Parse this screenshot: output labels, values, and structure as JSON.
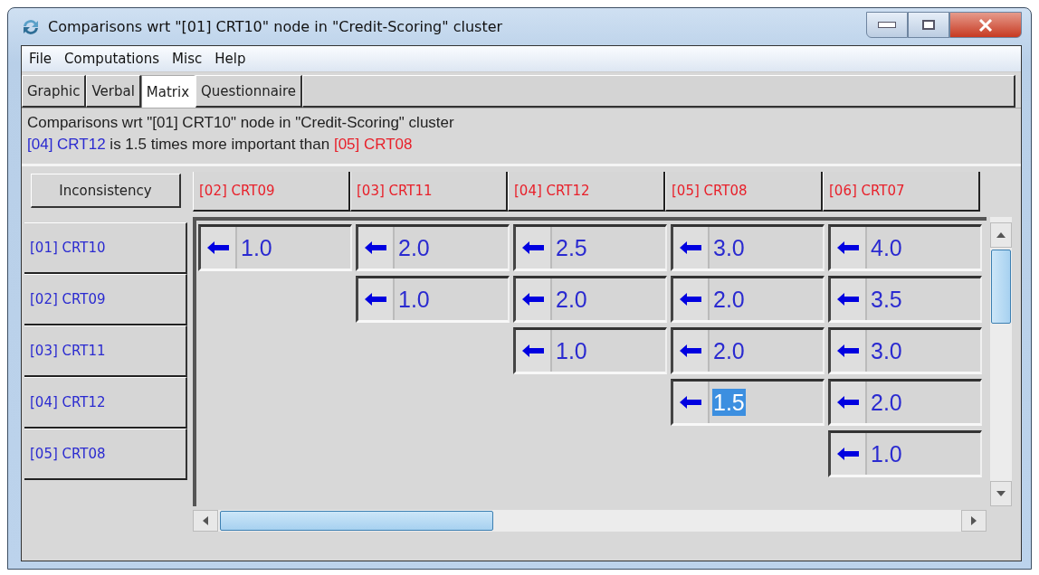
{
  "window": {
    "title": "Comparisons wrt \"[01] CRT10\" node in \"Credit-Scoring\" cluster"
  },
  "menu": [
    "File",
    "Computations",
    "Misc",
    "Help"
  ],
  "tabs": [
    {
      "label": "Graphic",
      "selected": false
    },
    {
      "label": "Verbal",
      "selected": false
    },
    {
      "label": "Matrix",
      "selected": true
    },
    {
      "label": "Questionnaire",
      "selected": false
    }
  ],
  "info": {
    "heading": "Comparisons wrt \"[01] CRT10\" node in \"Credit-Scoring\" cluster",
    "more_important": "[04] CRT12",
    "statement": "is 1.5 times more important than",
    "less_important": "[05] CRT08"
  },
  "inconsistency_button": "Inconsistency",
  "column_headers": [
    "[02] CRT09",
    "[03] CRT11",
    "[04] CRT12",
    "[05] CRT08",
    "[06] CRT07"
  ],
  "rows": [
    {
      "label": "[01] CRT10",
      "cells": [
        {
          "value": "1.0",
          "selected": false
        },
        {
          "value": "2.0",
          "selected": false
        },
        {
          "value": "2.5",
          "selected": false
        },
        {
          "value": "3.0",
          "selected": false
        },
        {
          "value": "4.0",
          "selected": false
        }
      ]
    },
    {
      "label": "[02] CRT09",
      "cells": [
        {
          "value": "1.0",
          "selected": false
        },
        {
          "value": "2.0",
          "selected": false
        },
        {
          "value": "2.0",
          "selected": false
        },
        {
          "value": "3.5",
          "selected": false
        }
      ]
    },
    {
      "label": "[03] CRT11",
      "cells": [
        {
          "value": "1.0",
          "selected": false
        },
        {
          "value": "2.0",
          "selected": false
        },
        {
          "value": "3.0",
          "selected": false
        }
      ]
    },
    {
      "label": "[04] CRT12",
      "cells": [
        {
          "value": "1.5",
          "selected": true
        },
        {
          "value": "2.0",
          "selected": false
        }
      ]
    },
    {
      "label": "[05] CRT08",
      "cells": [
        {
          "value": "1.0",
          "selected": false
        }
      ]
    }
  ]
}
